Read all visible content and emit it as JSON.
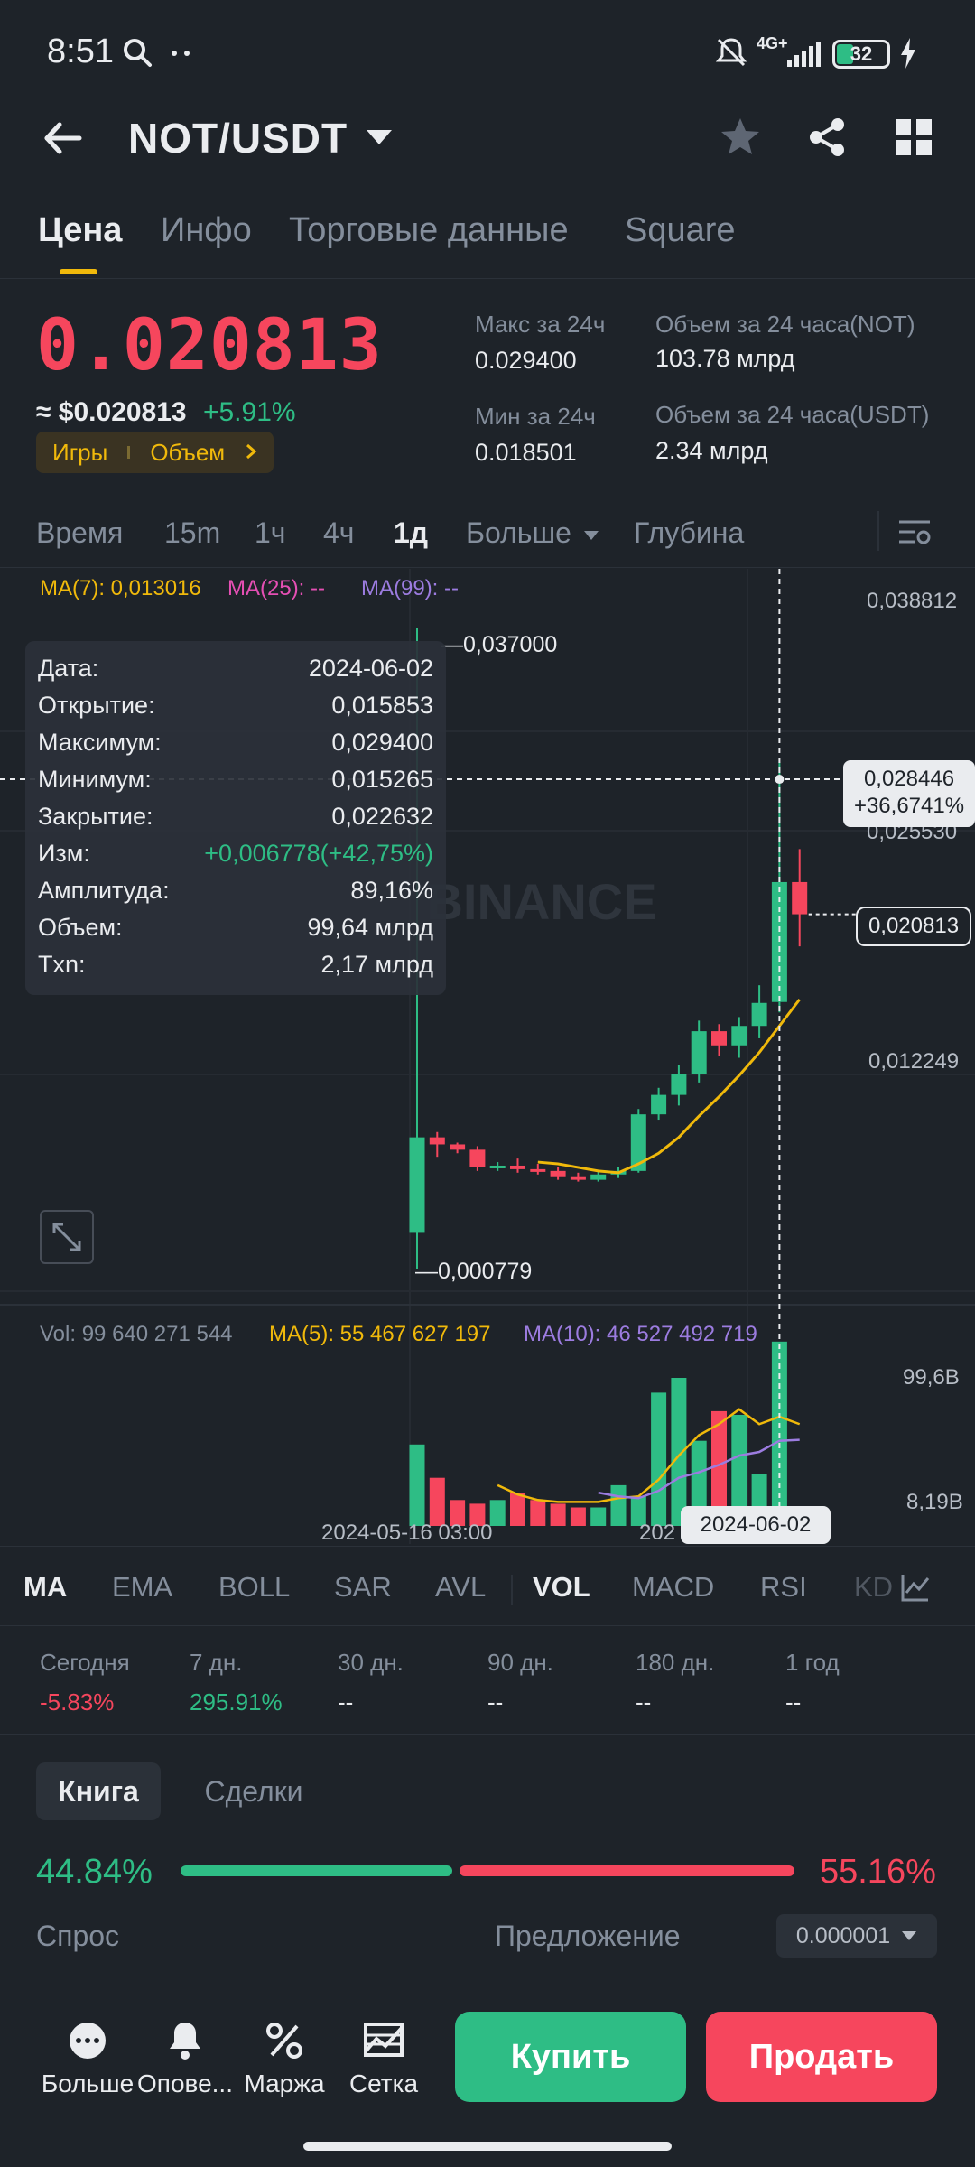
{
  "status_bar": {
    "time": "8:51",
    "network": "4G+",
    "battery": "32"
  },
  "header": {
    "pair": "NOT/USDT"
  },
  "tabs": [
    "Цена",
    "Инфо",
    "Торговые данные",
    "Square"
  ],
  "price": {
    "last": "0.020813",
    "usd": "≈ $0.020813",
    "change": "+5.91%",
    "tags": [
      "Игры",
      "Объем"
    ],
    "high_label": "Макс за 24ч",
    "high": "0.029400",
    "low_label": "Мин за 24ч",
    "low": "0.018501",
    "vol_not_label": "Объем за 24 часа(NOT)",
    "vol_not": "103.78 млрд",
    "vol_usdt_label": "Объем за 24 часа(USDT)",
    "vol_usdt": "2.34 млрд"
  },
  "intervals": [
    "Время",
    "15m",
    "1ч",
    "4ч",
    "1д",
    "Больше",
    "Глубина"
  ],
  "chart": {
    "ma7": "MA(7): 0,013016",
    "ma25": "MA(25): --",
    "ma99": "MA(99): --",
    "axis": [
      "0,038812",
      "0,025530",
      "0,012249"
    ],
    "peak_label": "0,037000",
    "low_label": "0,000779",
    "cursor_price": "0,028446",
    "cursor_pct": "+36,6741%",
    "last_price_tag": "0,020813",
    "watermark": "BINANCE",
    "tooltip": [
      {
        "k": "Дата:",
        "v": "2024-06-02"
      },
      {
        "k": "Открытие:",
        "v": "0,015853"
      },
      {
        "k": "Максимум:",
        "v": "0,029400"
      },
      {
        "k": "Минимум:",
        "v": "0,015265"
      },
      {
        "k": "Закрытие:",
        "v": "0,022632"
      },
      {
        "k": "Изм:",
        "v": "+0,006778(+42,75%)"
      },
      {
        "k": "Амплитуда:",
        "v": "89,16%"
      },
      {
        "k": "Объем:",
        "v": "99,64 млрд"
      },
      {
        "k": "Txn:",
        "v": "2,17 млрд"
      }
    ],
    "vol": "Vol: 99 640 271 544",
    "vol_ma5": "MA(5): 55 467 627 197",
    "vol_ma10": "MA(10): 46 527 492 719",
    "vol_axis": [
      "99,6B",
      "8,19B"
    ],
    "x_label_1": "2024-05-16 03:00",
    "x_label_2": "202",
    "cursor_date": "2024-06-02"
  },
  "chart_data": {
    "type": "candlestick",
    "ylim": [
      0.000779,
      0.038812
    ],
    "candles": [
      {
        "o": 0.0028,
        "h": 0.037,
        "l": 0.000779,
        "c": 0.0082
      },
      {
        "o": 0.0082,
        "h": 0.0085,
        "l": 0.0071,
        "c": 0.0078
      },
      {
        "o": 0.0078,
        "h": 0.0079,
        "l": 0.0073,
        "c": 0.0075
      },
      {
        "o": 0.0075,
        "h": 0.0077,
        "l": 0.0063,
        "c": 0.0065
      },
      {
        "o": 0.0065,
        "h": 0.0068,
        "l": 0.0063,
        "c": 0.0066
      },
      {
        "o": 0.0066,
        "h": 0.007,
        "l": 0.0062,
        "c": 0.0064
      },
      {
        "o": 0.0064,
        "h": 0.0067,
        "l": 0.0061,
        "c": 0.0063
      },
      {
        "o": 0.0063,
        "h": 0.0065,
        "l": 0.0058,
        "c": 0.006
      },
      {
        "o": 0.006,
        "h": 0.0062,
        "l": 0.0057,
        "c": 0.0058
      },
      {
        "o": 0.0058,
        "h": 0.0063,
        "l": 0.0057,
        "c": 0.0061
      },
      {
        "o": 0.0061,
        "h": 0.0065,
        "l": 0.0059,
        "c": 0.0063
      },
      {
        "o": 0.0063,
        "h": 0.0098,
        "l": 0.0062,
        "c": 0.0095
      },
      {
        "o": 0.0095,
        "h": 0.011,
        "l": 0.0092,
        "c": 0.0106
      },
      {
        "o": 0.0106,
        "h": 0.0123,
        "l": 0.01,
        "c": 0.0118
      },
      {
        "o": 0.0118,
        "h": 0.0148,
        "l": 0.0113,
        "c": 0.0142
      },
      {
        "o": 0.0142,
        "h": 0.0146,
        "l": 0.0128,
        "c": 0.0134
      },
      {
        "o": 0.0134,
        "h": 0.015,
        "l": 0.0127,
        "c": 0.0145
      },
      {
        "o": 0.0145,
        "h": 0.0168,
        "l": 0.0138,
        "c": 0.0158
      },
      {
        "o": 0.015853,
        "h": 0.0294,
        "l": 0.015265,
        "c": 0.022632
      },
      {
        "o": 0.022632,
        "h": 0.0245,
        "l": 0.019,
        "c": 0.020813
      }
    ],
    "ma7": [
      null,
      null,
      null,
      null,
      null,
      null,
      0.0068,
      0.0067,
      0.0065,
      0.0063,
      0.0062,
      0.0067,
      0.0073,
      0.0082,
      0.0094,
      0.0105,
      0.0117,
      0.013,
      0.0145,
      0.016
    ],
    "volume": [
      44,
      26,
      14,
      12,
      14,
      18,
      14,
      12,
      10,
      10,
      22,
      16,
      72,
      80,
      46,
      62,
      60,
      28,
      99.6,
      8.19
    ],
    "vol_ma5": [
      null,
      null,
      null,
      null,
      22,
      17,
      14,
      13,
      13,
      13,
      15,
      16,
      25,
      38,
      49,
      55,
      63,
      55,
      59,
      55
    ],
    "vol_ma10": [
      null,
      null,
      null,
      null,
      null,
      null,
      null,
      null,
      null,
      18,
      16,
      15,
      19,
      26,
      29,
      33,
      38,
      40,
      46,
      46.5
    ]
  },
  "indicators": [
    "MA",
    "EMA",
    "BOLL",
    "SAR",
    "AVL",
    "VOL",
    "MACD",
    "RSI",
    "KD"
  ],
  "periods": [
    {
      "label": "Сегодня",
      "value": "-5.83%"
    },
    {
      "label": "7 дн.",
      "value": "295.91%"
    },
    {
      "label": "30 дн.",
      "value": "--"
    },
    {
      "label": "90 дн.",
      "value": "--"
    },
    {
      "label": "180 дн.",
      "value": "--"
    },
    {
      "label": "1 год",
      "value": "--"
    }
  ],
  "book": {
    "tabs": [
      "Книга",
      "Сделки"
    ],
    "bid_pct": "44.84%",
    "ask_pct": "55.16%",
    "bid_fraction": 0.4484,
    "bid_label": "Спрос",
    "ask_label": "Предложение",
    "precision": "0.000001"
  },
  "bottom": {
    "nav": [
      "Больше",
      "Опове...",
      "Маржа",
      "Сетка"
    ],
    "buy": "Купить",
    "sell": "Продать"
  },
  "colors": {
    "up": "#2ebd85",
    "down": "#f6465d",
    "accent": "#f0b90b",
    "bg": "#1e2329"
  }
}
